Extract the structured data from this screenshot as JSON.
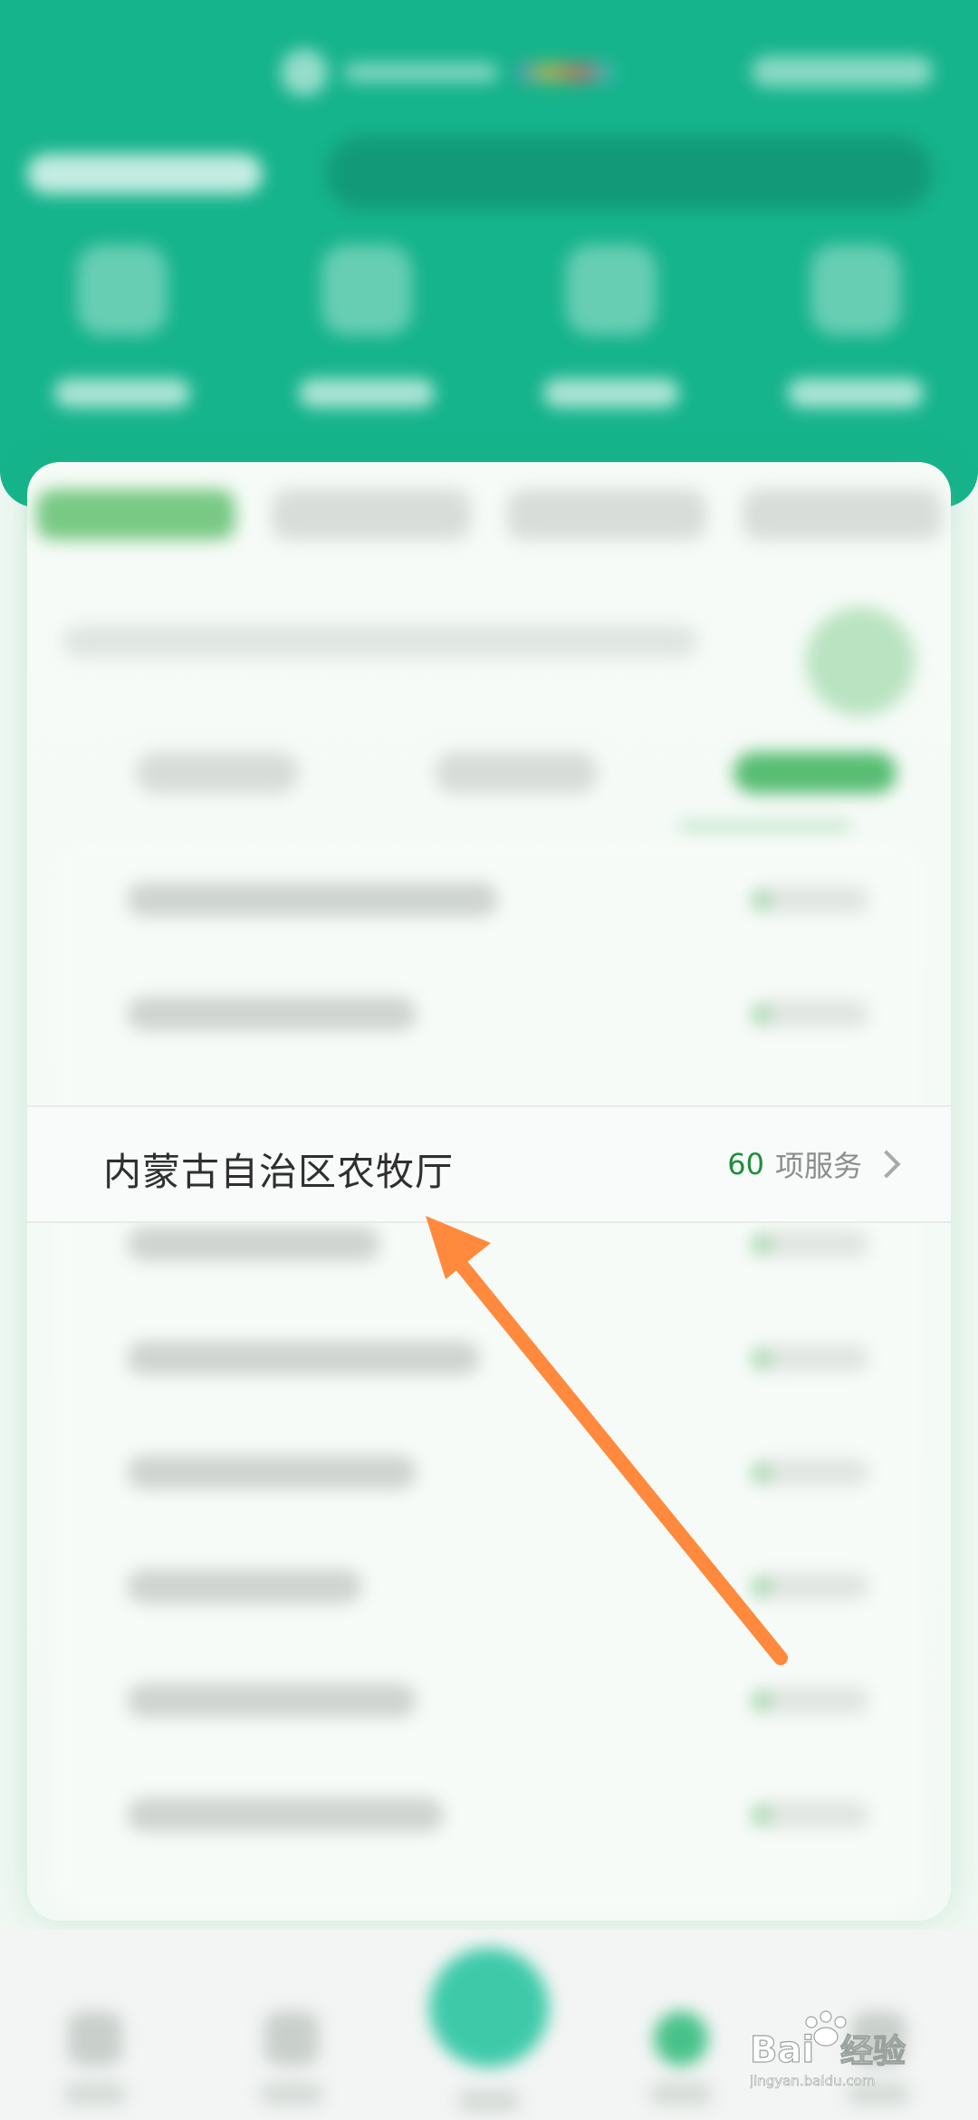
{
  "agency_list": {
    "focused_item": {
      "name": "内蒙古自治区农牧厅",
      "service_count": "60",
      "service_unit": "项服务"
    }
  },
  "watermark": {
    "brand": "Baidu",
    "product": "经验",
    "url": "jingyan.baidu.com"
  },
  "annotation": {
    "arrow_color": "#ff8a3d"
  },
  "colors": {
    "brand_green": "#16b48c",
    "count_green": "#1d8f3c"
  }
}
